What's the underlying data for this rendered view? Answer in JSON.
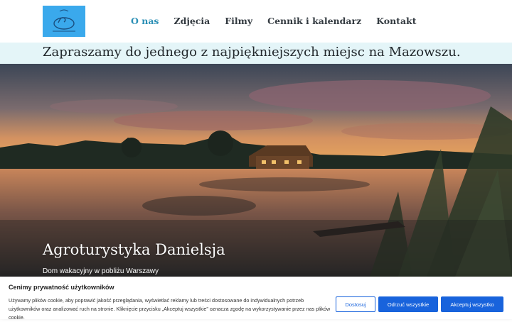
{
  "header": {
    "logo_icon": "swan-logo-icon",
    "nav": [
      {
        "label": "O nas",
        "active": true
      },
      {
        "label": "Zdjęcia",
        "active": false
      },
      {
        "label": "Filmy",
        "active": false
      },
      {
        "label": "Cennik i kalendarz",
        "active": false
      },
      {
        "label": "Kontakt",
        "active": false
      }
    ]
  },
  "tagline": "Zapraszamy do jednego z najpiękniejszych miejsc na Mazowszu.",
  "hero": {
    "title": "Agroturystyka Danielsja",
    "subtitle": "Dom wakacyjny w pobliżu Warszawy"
  },
  "cookie": {
    "title": "Cenimy prywatność użytkowników",
    "text": "Używamy plików cookie, aby poprawić jakość przeglądania, wyświetlać reklamy lub treści dostosowane do indywidualnych potrzeb użytkowników oraz analizować ruch na stronie. Kliknięcie przycisku „Akceptuj wszystkie” oznacza zgodę na wykorzystywanie przez nas plików cookie.",
    "buttons": {
      "customize": "Dostosuj",
      "reject": "Odrzuć wszystkie",
      "accept": "Akceptuj wszystko"
    }
  },
  "colors": {
    "accent": "#2a8fb5",
    "tagline_band": "#e4f5f8",
    "button_blue": "#1863dc",
    "logo_bg": "#3aa9ec"
  }
}
